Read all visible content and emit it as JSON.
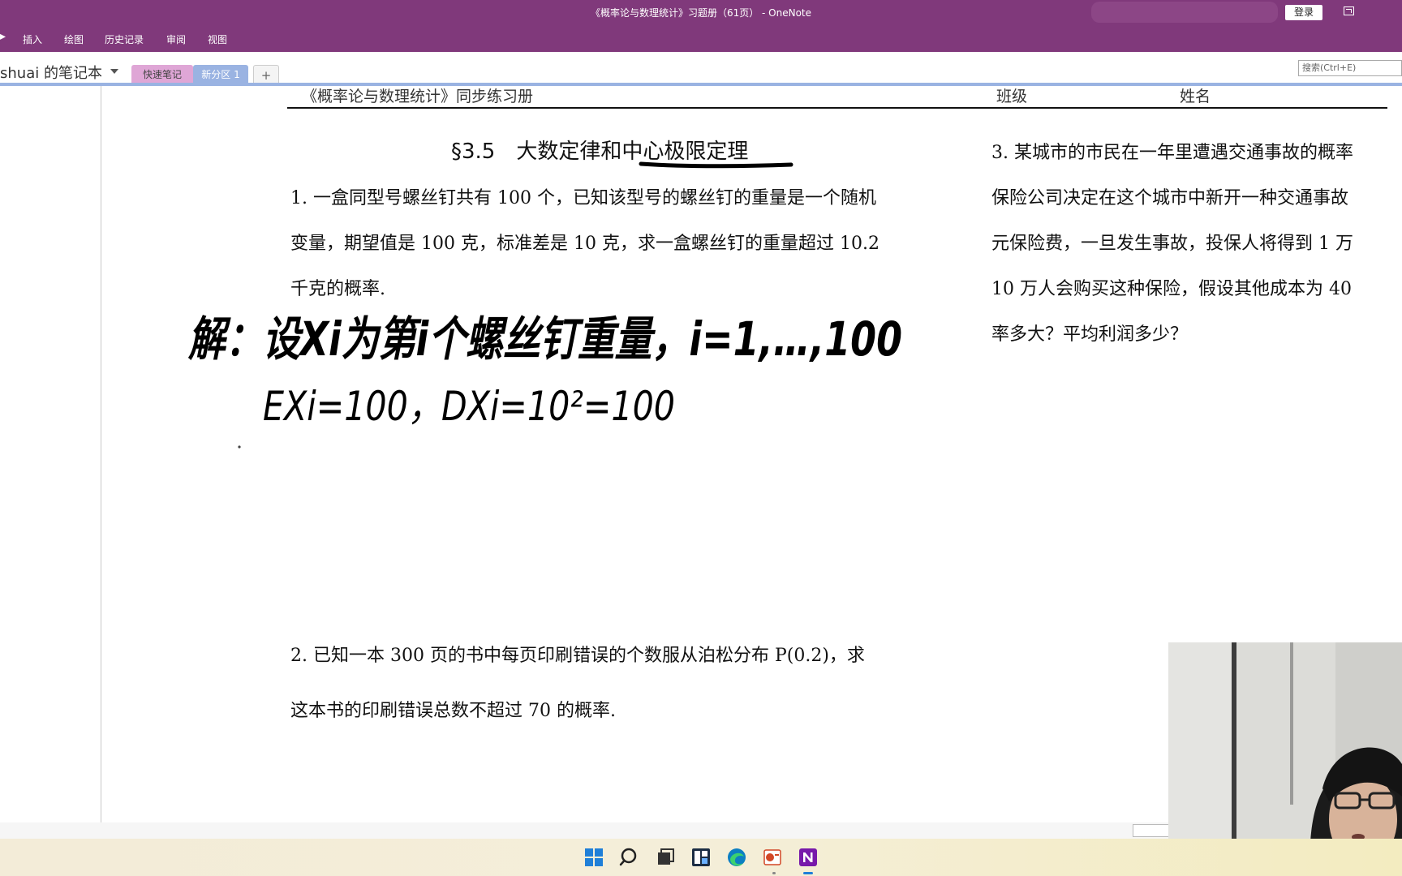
{
  "window": {
    "title": "《概率论与数理统计》习题册（61页） - OneNote",
    "login_label": "登录"
  },
  "ribbon": {
    "tabs": [
      "插入",
      "绘图",
      "历史记录",
      "审阅",
      "视图"
    ]
  },
  "notebook": {
    "name": "shuai 的笔记本",
    "sections": [
      "快速笔记",
      "新分区 1"
    ],
    "add_label": "+",
    "search_placeholder": "搜索(Ctrl+E)"
  },
  "page": {
    "header_left": "《概率论与数理统计》同步练习册",
    "header_class": "班级",
    "header_name": "姓名",
    "section_title": "§3.5　大数定律和中心极限定理",
    "problem1": [
      "1. 一盒同型号螺丝钉共有 100 个，已知该型号的螺丝钉的重量是一个随机",
      "变量，期望值是 100 克，标准差是 10 克，求一盒螺丝钉的重量超过 10.2",
      "千克的概率."
    ],
    "problem2": [
      "2. 已知一本 300 页的书中每页印刷错误的个数服从泊松分布 P(0.2)，求",
      "这本书的印刷错误总数不超过 70 的概率."
    ],
    "problem3": [
      "3. 某城市的市民在一年里遭遇交通事故的概率",
      "保险公司决定在这个城市中新开一种交通事故",
      "元保险费，一旦发生事故，投保人将得到 1 万",
      "10 万人会购买这种保险，假设其他成本为 40",
      "率多大？平均利润多少？"
    ],
    "handwriting": {
      "line1": "解：设Xi为第i个螺丝钉重量，i=1,…,100",
      "line2": "EXi=100，DXi=10²=100"
    }
  },
  "taskbar": {
    "icons": [
      "windows-start-icon",
      "search-icon",
      "task-view-icon",
      "widgets-icon",
      "edge-browser-icon",
      "powerpoint-icon",
      "onenote-icon"
    ]
  },
  "colors": {
    "onenote_purple": "#80397b",
    "section_quick": "#dfa6d6",
    "section_new": "#9ab3e2"
  }
}
